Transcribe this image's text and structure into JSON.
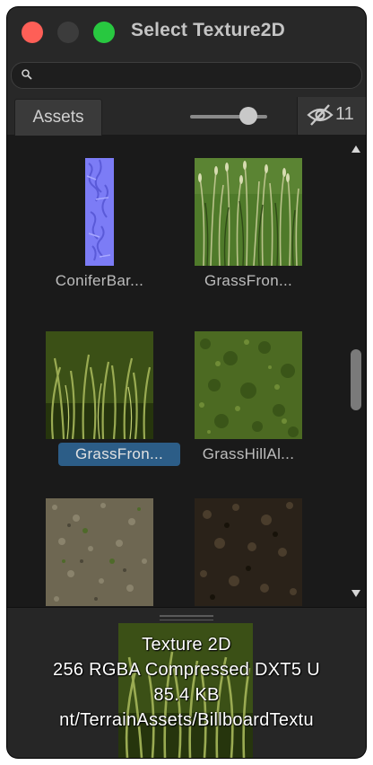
{
  "window": {
    "title": "Select Texture2D"
  },
  "search": {
    "value": "",
    "placeholder": ""
  },
  "toolbar": {
    "tab_label": "Assets",
    "zoom_level": 0.75,
    "hidden_count": "11"
  },
  "grid": {
    "items": [
      {
        "label": "ConiferBar...",
        "texture": "normal-map-bark",
        "selected": false
      },
      {
        "label": "GrassFron...",
        "texture": "tall-grass-billboard",
        "selected": false
      },
      {
        "label": "GrassFron...",
        "texture": "grass-blades",
        "selected": true
      },
      {
        "label": "GrassHillAl...",
        "texture": "grass-ground",
        "selected": false
      },
      {
        "label": "",
        "texture": "gravel-ground",
        "selected": false
      },
      {
        "label": "",
        "texture": "dark-soil",
        "selected": false
      }
    ]
  },
  "preview": {
    "type": "Texture 2D",
    "format": "256  RGBA Compressed DXT5 U",
    "size": "85.4 KB",
    "path": "nt/TerrainAssets/BillboardTextu"
  },
  "colors": {
    "selection": "#2c5d87",
    "close": "#fe5f57",
    "maximize": "#28c840"
  }
}
